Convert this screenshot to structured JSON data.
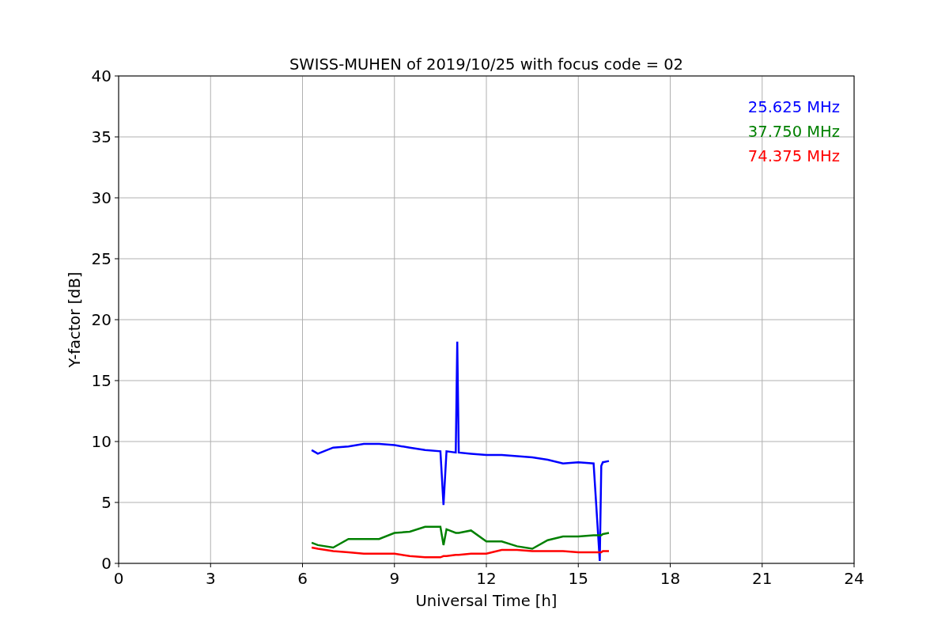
{
  "chart_data": {
    "type": "line",
    "title": "SWISS-MUHEN of 2019/10/25 with focus code = 02",
    "xlabel": "Universal Time [h]",
    "ylabel": "Y-factor [dB]",
    "x": [
      6.3,
      6.5,
      7,
      7.5,
      8,
      8.5,
      9,
      9.5,
      10,
      10.5,
      10.6,
      10.7,
      11,
      11.05,
      11.1,
      11.5,
      12,
      12.5,
      13,
      13.5,
      14,
      14.5,
      15,
      15.5,
      15.7,
      15.75,
      15.8,
      16
    ],
    "series": [
      {
        "name": "25.625 MHz",
        "color": "#0000ff",
        "values": [
          9.3,
          9.0,
          9.5,
          9.6,
          9.8,
          9.8,
          9.7,
          9.5,
          9.3,
          9.2,
          4.8,
          9.2,
          9.1,
          18.2,
          9.1,
          9.0,
          8.9,
          8.9,
          8.8,
          8.7,
          8.5,
          8.2,
          8.3,
          8.2,
          0.2,
          8.0,
          8.3,
          8.4
        ]
      },
      {
        "name": "37.750 MHz",
        "color": "#008000",
        "values": [
          1.7,
          1.5,
          1.3,
          2.0,
          2.0,
          2.0,
          2.5,
          2.6,
          3.0,
          3.0,
          1.5,
          2.8,
          2.5,
          2.5,
          2.5,
          2.7,
          1.8,
          1.8,
          1.4,
          1.2,
          1.9,
          2.2,
          2.2,
          2.3,
          2.3,
          2.3,
          2.4,
          2.5
        ]
      },
      {
        "name": "74.375 MHz",
        "color": "#ff0000",
        "values": [
          1.3,
          1.2,
          1.0,
          0.9,
          0.8,
          0.8,
          0.8,
          0.6,
          0.5,
          0.5,
          0.6,
          0.6,
          0.7,
          0.7,
          0.7,
          0.8,
          0.8,
          1.1,
          1.1,
          1.0,
          1.0,
          1.0,
          0.9,
          0.9,
          0.9,
          0.9,
          1.0,
          1.0
        ]
      }
    ],
    "xlim": [
      0,
      24
    ],
    "ylim": [
      0,
      40
    ],
    "xticks": [
      0,
      3,
      6,
      9,
      12,
      15,
      18,
      21,
      24
    ],
    "yticks": [
      0,
      5,
      10,
      15,
      20,
      25,
      30,
      35,
      40
    ],
    "grid": true
  }
}
